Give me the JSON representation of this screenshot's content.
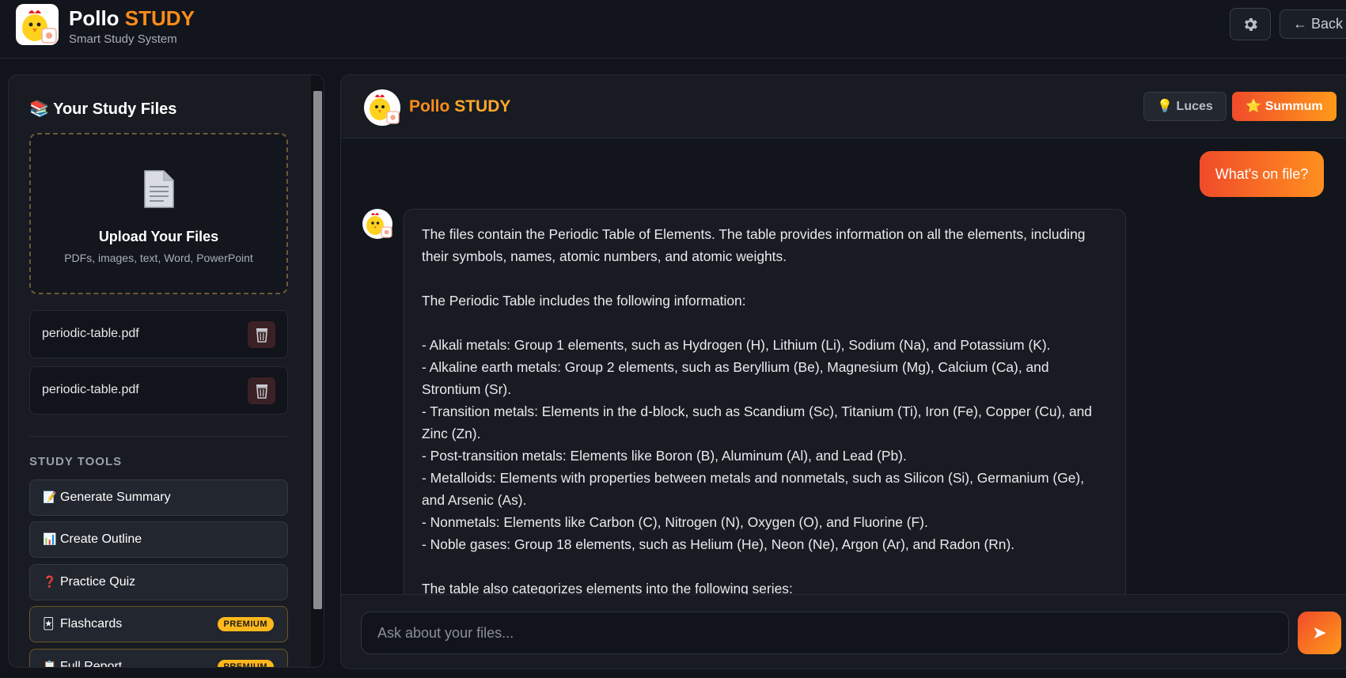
{
  "app": {
    "title_main": "Pollo",
    "title_accent": "STUDY",
    "subtitle": "Smart Study System",
    "back_label": "← Back"
  },
  "sidebar": {
    "title": "📚 Your Study Files",
    "upload_title": "Upload Your Files",
    "upload_subtitle": "PDFs, images, text, Word, PowerPoint",
    "files": [
      {
        "name": "periodic-table.pdf"
      },
      {
        "name": "periodic-table.pdf"
      }
    ],
    "tools_heading": "STUDY TOOLS",
    "tools": [
      {
        "icon": "📝",
        "label": "Generate Summary",
        "premium": false
      },
      {
        "icon": "📊",
        "label": "Create Outline",
        "premium": false
      },
      {
        "icon": "❓",
        "label": "Practice Quiz",
        "premium": false
      },
      {
        "icon": "🃏",
        "label": "Flashcards",
        "premium": true
      },
      {
        "icon": "📋",
        "label": "Full Report",
        "premium": true
      }
    ],
    "premium_badge": "PREMIUM"
  },
  "chat": {
    "title_main": "Pollo",
    "title_accent": "STUDY",
    "mode_luces": "💡 Luces",
    "mode_summum": "⭐ Summum",
    "user_message": "What's on file?",
    "bot_paragraphs": [
      "The files contain the Periodic Table of Elements. The table provides information on all the elements, including their symbols, names, atomic numbers, and atomic weights.",
      "",
      "The Periodic Table includes the following information:",
      "",
      "- Alkali metals: Group 1 elements, such as Hydrogen (H), Lithium (Li), Sodium (Na), and Potassium (K).",
      "- Alkaline earth metals: Group 2 elements, such as Beryllium (Be), Magnesium (Mg), Calcium (Ca), and Strontium (Sr).",
      "- Transition metals: Elements in the d-block, such as Scandium (Sc), Titanium (Ti), Iron (Fe), Copper (Cu), and Zinc (Zn).",
      "- Post-transition metals: Elements like Boron (B), Aluminum (Al), and Lead (Pb).",
      "- Metalloids: Elements with properties between metals and nonmetals, such as Silicon (Si), Germanium (Ge), and Arsenic (As).",
      "- Nonmetals: Elements like Carbon (C), Nitrogen (N), Oxygen (O), and Fluorine (F).",
      "- Noble gases: Group 18 elements, such as Helium (He), Neon (Ne), Argon (Ar), and Radon (Rn).",
      "",
      "The table also categorizes elements into the following series:"
    ],
    "input_placeholder": "Ask about your files...",
    "send_icon": "➤"
  },
  "colors": {
    "accent": "#ff8c1a",
    "gradient_start": "#f04b2a",
    "gradient_end": "#ff9a1a",
    "premium": "#ffb81c"
  }
}
